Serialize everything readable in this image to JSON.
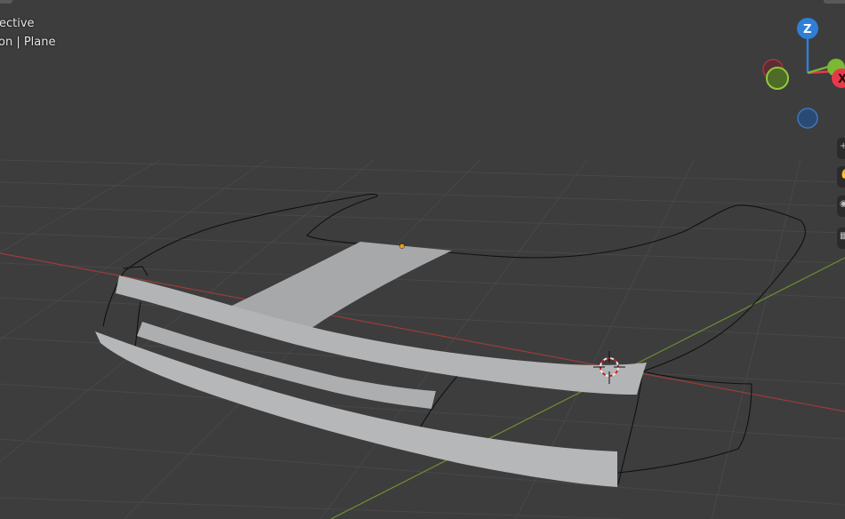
{
  "viewport": {
    "view_mode_text": "ective",
    "object_text": "on | Plane"
  },
  "gizmo": {
    "z_label": "Z",
    "x_label": "X",
    "colors": {
      "x": "#e8394a",
      "y": "#7bb834",
      "z": "#2f7fd8"
    }
  },
  "nav_buttons": [
    {
      "icon": "zoom-icon"
    },
    {
      "icon": "hand-pan-icon"
    },
    {
      "icon": "camera-icon"
    },
    {
      "icon": "grid-ortho-icon"
    }
  ],
  "colors": {
    "background": "#3d3d3d",
    "grid": "#4a4a4a",
    "x_axis": "#a83a3a",
    "y_axis": "#6b9a2a",
    "mesh_fill": "#b5b6b8",
    "outline": "#111111"
  }
}
